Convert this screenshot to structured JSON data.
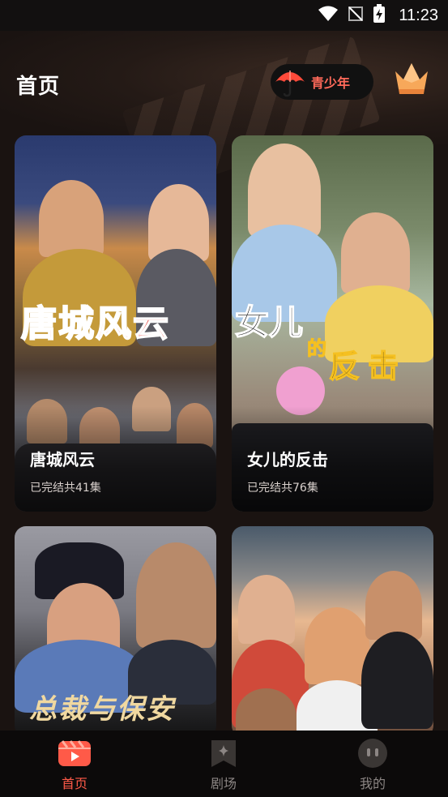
{
  "status_bar": {
    "time": "11:23"
  },
  "header": {
    "title": "首页",
    "youth_mode_label": "青少年"
  },
  "dramas": [
    {
      "title": "唐城风云",
      "status": "已完结共41集",
      "poster_text": "唐城风云"
    },
    {
      "title": "女儿的反击",
      "status": "已完结共76集",
      "poster_text_line1": "女儿",
      "poster_text_line2": "的",
      "poster_text_line3": "反击"
    },
    {
      "title": "",
      "status": "",
      "poster_text": "总裁与保安"
    },
    {
      "title": "",
      "status": "",
      "poster_text": ""
    }
  ],
  "bottom_nav": {
    "items": [
      {
        "label": "首页",
        "icon": "home-clapper-icon",
        "active": true
      },
      {
        "label": "剧场",
        "icon": "theater-sparkle-icon",
        "active": false
      },
      {
        "label": "我的",
        "icon": "profile-face-icon",
        "active": false
      }
    ]
  },
  "colors": {
    "accent": "#ff5a48",
    "background": "#1a1311",
    "nav_bg": "#0c0a0a"
  }
}
